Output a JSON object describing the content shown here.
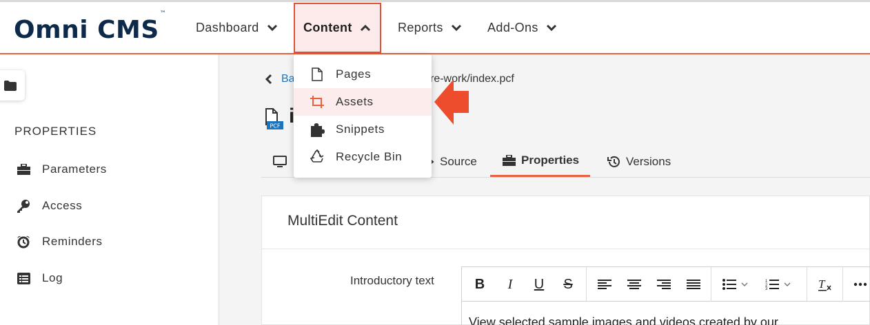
{
  "app": {
    "logo": "Omni CMS",
    "trademark": "™"
  },
  "nav": {
    "items": [
      {
        "label": "Dashboard"
      },
      {
        "label": "Content"
      },
      {
        "label": "Reports"
      },
      {
        "label": "Add-Ons"
      }
    ]
  },
  "content_menu": {
    "items": [
      {
        "label": "Pages",
        "icon": "page-icon"
      },
      {
        "label": "Assets",
        "icon": "crop-icon"
      },
      {
        "label": "Snippets",
        "icon": "puzzle-icon"
      },
      {
        "label": "Recycle Bin",
        "icon": "recycle-icon"
      }
    ],
    "highlighted": "Assets"
  },
  "sidebar": {
    "heading": "PROPERTIES",
    "items": [
      {
        "label": "Parameters",
        "icon": "toolbox-icon"
      },
      {
        "label": "Access",
        "icon": "key-icon"
      },
      {
        "label": "Reminders",
        "icon": "alarm-clock-icon"
      },
      {
        "label": "Log",
        "icon": "list-icon"
      }
    ]
  },
  "breadcrumb": {
    "back_label": "Ba",
    "path": "re-work/index.pcf"
  },
  "page": {
    "title_fragment": "i",
    "file_badge": "PCF"
  },
  "tabs": [
    {
      "label": "Source",
      "icon": "source-icon"
    },
    {
      "label": "Properties",
      "icon": "toolbox-icon"
    },
    {
      "label": "Versions",
      "icon": "history-icon"
    }
  ],
  "active_tab": "Properties",
  "card": {
    "title": "MultiEdit Content",
    "field_label": "Introductory text",
    "editor_text": "View selected sample images and videos created by our"
  },
  "colors": {
    "accent": "#e8603c",
    "brand_navy": "#0e2a4b",
    "link": "#1c75bc",
    "highlight_bg": "#fdecec"
  }
}
